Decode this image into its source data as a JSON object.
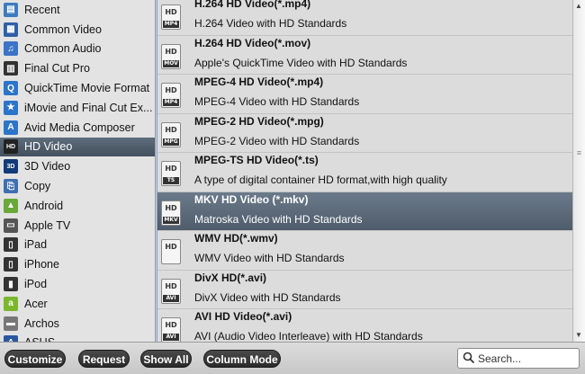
{
  "categories": [
    {
      "label": "Recent",
      "icon": "folder-icon",
      "selected": false
    },
    {
      "label": "Common Video",
      "icon": "film-icon",
      "selected": false
    },
    {
      "label": "Common Audio",
      "icon": "music-note-icon",
      "selected": false
    },
    {
      "label": "Final Cut Pro",
      "icon": "clapper-icon",
      "selected": false
    },
    {
      "label": "QuickTime Movie Format",
      "icon": "quicktime-icon",
      "selected": false
    },
    {
      "label": "iMovie and Final Cut Ex...",
      "icon": "imovie-icon",
      "selected": false
    },
    {
      "label": "Avid Media Composer",
      "icon": "avid-icon",
      "selected": false
    },
    {
      "label": "HD Video",
      "icon": "hd-icon",
      "selected": true
    },
    {
      "label": "3D Video",
      "icon": "3d-icon",
      "selected": false
    },
    {
      "label": "Copy",
      "icon": "copy-icon",
      "selected": false
    },
    {
      "label": "Android",
      "icon": "android-icon",
      "selected": false
    },
    {
      "label": "Apple TV",
      "icon": "apple-tv-icon",
      "selected": false
    },
    {
      "label": "iPad",
      "icon": "ipad-icon",
      "selected": false
    },
    {
      "label": "iPhone",
      "icon": "iphone-icon",
      "selected": false
    },
    {
      "label": "iPod",
      "icon": "ipod-icon",
      "selected": false
    },
    {
      "label": "Acer",
      "icon": "acer-icon",
      "selected": false
    },
    {
      "label": "Archos",
      "icon": "archos-icon",
      "selected": false
    },
    {
      "label": "ASUS",
      "icon": "asus-icon",
      "selected": false
    }
  ],
  "formats": [
    {
      "title": "H.264 HD Video(*.mp4)",
      "description": "H.264 Video with HD Standards",
      "tag": "MP4",
      "selected": false
    },
    {
      "title": "H.264 HD Video(*.mov)",
      "description": "Apple's QuickTime Video with HD Standards",
      "tag": "MOV",
      "selected": false
    },
    {
      "title": "MPEG-4 HD Video(*.mp4)",
      "description": "MPEG-4 Video with HD Standards",
      "tag": "MP4",
      "selected": false
    },
    {
      "title": "MPEG-2 HD Video(*.mpg)",
      "description": "MPEG-2 Video with HD Standards",
      "tag": "MPG",
      "selected": false
    },
    {
      "title": "MPEG-TS HD Video(*.ts)",
      "description": "A type of digital container HD format,with high quality",
      "tag": "TS",
      "selected": false
    },
    {
      "title": "MKV HD Video (*.mkv)",
      "description": "Matroska Video with HD Standards",
      "tag": "MKV",
      "selected": true
    },
    {
      "title": "WMV HD(*.wmv)",
      "description": "WMV Video with HD Standards",
      "tag": "",
      "selected": false
    },
    {
      "title": "DivX HD(*.avi)",
      "description": "DivX Video with HD Standards",
      "tag": "AVI",
      "selected": false
    },
    {
      "title": "AVI HD Video(*.avi)",
      "description": "AVI (Audio Video Interleave) with HD Standards",
      "tag": "AVI",
      "selected": false
    }
  ],
  "format_icon_text": "HD",
  "toolbar": {
    "customize_label": "Customize",
    "request_label": "Request",
    "show_all_label": "Show All",
    "column_mode_label": "Column Mode"
  },
  "search": {
    "placeholder": "Search...",
    "value": ""
  },
  "scrollbar": {
    "up_glyph": "▲",
    "grip_glyph": "≡",
    "down_glyph": "▼"
  },
  "colors": {
    "selection_dark": "#4e5c6b",
    "sidebar_bg": "#e3e3e3",
    "formats_bg": "#dcdcdc",
    "button_bg": "#2a2a2a"
  }
}
